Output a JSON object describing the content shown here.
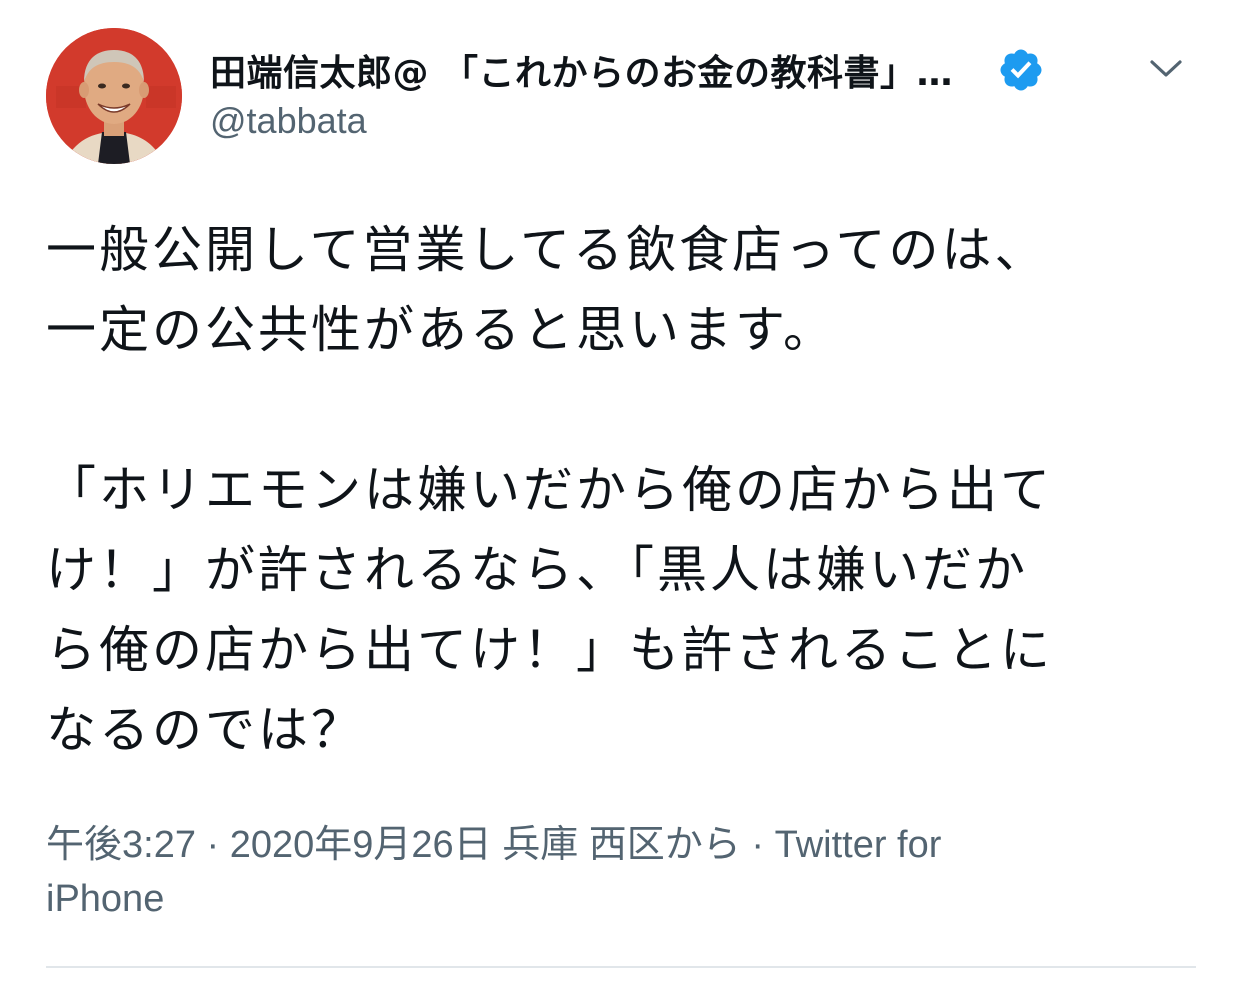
{
  "tweet": {
    "author": {
      "display_name": "田端信太郎@ 「これからのお金の教科書」…",
      "handle": "@tabbata",
      "verified": true,
      "avatar_icon": "avatar-photo",
      "verified_icon": "verified-badge-icon",
      "menu_icon": "chevron-down-icon"
    },
    "body": {
      "paragraph1_line1": "一般公開して営業してる飲食店ってのは、",
      "paragraph1_line2": "一定の公共性があると思います。",
      "paragraph2_line1": "「ホリエモンは嫌いだから俺の店から出て",
      "paragraph2_line2": "け！」が許されるなら、「黒人は嫌いだか",
      "paragraph2_line3": "ら俺の店から出てけ！」も許されることに",
      "paragraph2_line4": "なるのでは？"
    },
    "meta": {
      "time": "午後3:27",
      "separator1": " · ",
      "date": "2020年9月26日",
      "location": "兵庫 西区から",
      "separator2": " · ",
      "source_part1": "Twitter for",
      "source_part2": "iPhone"
    },
    "colors": {
      "text": "#0f1419",
      "secondary": "#536471",
      "verified_blue": "#1d9bf0",
      "divider": "#e1e6ea"
    }
  }
}
